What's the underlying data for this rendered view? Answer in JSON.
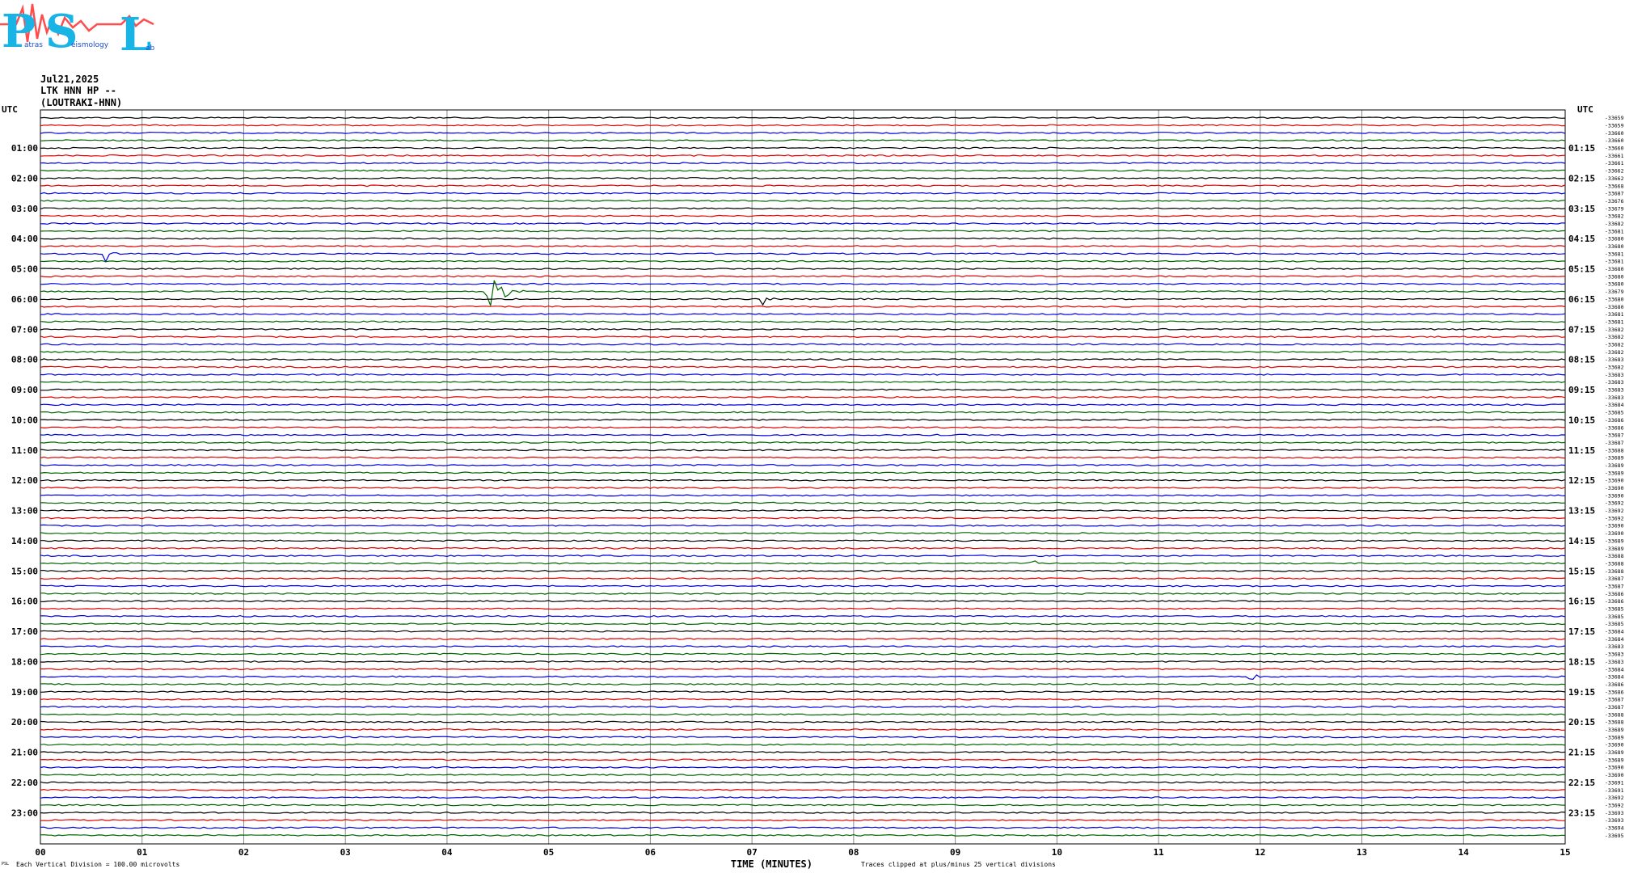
{
  "logo": {
    "letters": [
      "P",
      "S",
      "L"
    ],
    "words": [
      "Patras",
      "Seismology",
      "Lab"
    ]
  },
  "header": {
    "date": "Jul21,2025",
    "station": "LTK HNN HP --",
    "location": "(LOUTRAKI-HNN)"
  },
  "chart_data": {
    "type": "line",
    "title": "",
    "xlabel": "TIME (MINUTES)",
    "xticks": [
      "00",
      "01",
      "02",
      "03",
      "04",
      "05",
      "06",
      "07",
      "08",
      "09",
      "10",
      "11",
      "12",
      "13",
      "14",
      "15"
    ],
    "xlim": [
      0,
      15
    ],
    "left_axis_title": "UTC",
    "right_axis_title": "UTC",
    "left_hour_labels": [
      "01:00",
      "02:00",
      "03:00",
      "04:00",
      "05:00",
      "06:00",
      "07:00",
      "08:00",
      "09:00",
      "10:00",
      "11:00",
      "12:00",
      "13:00",
      "14:00",
      "15:00",
      "16:00",
      "17:00",
      "18:00",
      "19:00",
      "20:00",
      "21:00",
      "22:00",
      "23:00"
    ],
    "right_hour_labels": [
      "01:15",
      "02:15",
      "03:15",
      "04:15",
      "05:15",
      "06:15",
      "07:15",
      "08:15",
      "09:15",
      "10:15",
      "11:15",
      "12:15",
      "13:15",
      "14:15",
      "15:15",
      "16:15",
      "17:15",
      "18:15",
      "19:15",
      "20:15",
      "21:15",
      "22:15",
      "23:15"
    ],
    "trace_colors": [
      "#000000",
      "#e00000",
      "#0000e0",
      "#006400"
    ],
    "trace_count": 96,
    "trace_minutes": 15,
    "right_values": [
      33659,
      33659,
      33660,
      33660,
      33660,
      33661,
      33661,
      33662,
      33662,
      33668,
      33687,
      33676,
      33679,
      33682,
      33682,
      33681,
      33680,
      33680,
      33681,
      33681,
      33680,
      33680,
      33680,
      33679,
      33680,
      33680,
      33681,
      33681,
      33682,
      33682,
      33682,
      33682,
      33683,
      33682,
      33683,
      33683,
      33683,
      33683,
      33684,
      33685,
      33686,
      33686,
      33687,
      33687,
      33688,
      33689,
      33689,
      33689,
      33690,
      33690,
      33690,
      33692,
      33692,
      33692,
      33690,
      33690,
      33689,
      33689,
      33688,
      33688,
      33688,
      33687,
      33687,
      33686,
      33686,
      33685,
      33685,
      33685,
      33684,
      33684,
      33683,
      33683,
      33683,
      33684,
      33684,
      33686,
      33686,
      33687,
      33687,
      33688,
      33688,
      33689,
      33689,
      33690,
      33689,
      33689,
      33690,
      33690,
      33691,
      33691,
      33692,
      33692,
      33693,
      33693,
      33694,
      33695
    ],
    "events": [
      {
        "trace": 18,
        "minute": 0.65,
        "amplitude": 0.55,
        "duration": 0.2
      },
      {
        "trace": 23,
        "minute": 4.38,
        "amplitude": 1.6,
        "duration": 0.4
      },
      {
        "trace": 24,
        "minute": 7.1,
        "amplitude": 0.45,
        "duration": 0.15
      },
      {
        "trace": 59,
        "minute": 9.75,
        "amplitude": 0.3,
        "duration": 0.25
      },
      {
        "trace": 58,
        "minute": 11.7,
        "amplitude": 0.25,
        "duration": 0.1
      },
      {
        "trace": 74,
        "minute": 11.9,
        "amplitude": 0.35,
        "duration": 0.2
      }
    ]
  },
  "footer": {
    "scale_note": "Each Vertical Division =  100.00 microvolts",
    "clip_note": "Traces clipped at plus/minus 25 vertical divisions",
    "corner_mark": "PSL"
  }
}
